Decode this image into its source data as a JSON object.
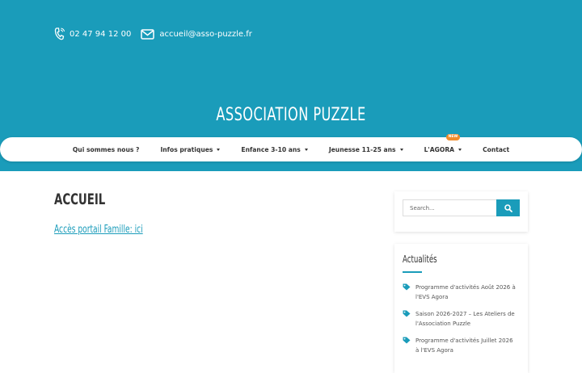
{
  "contact": {
    "phone": "02 47 94 12 00",
    "email": "accueil@asso-puzzle.fr",
    "phone_icon": "phone-icon",
    "email_icon": "envelope-icon"
  },
  "site": {
    "title": "ASSOCIATION PUZZLE"
  },
  "nav": {
    "items": [
      {
        "label": "Qui sommes nous ?",
        "dropdown": false
      },
      {
        "label": "Infos pratiques",
        "dropdown": true
      },
      {
        "label": "Enfance 3-10 ans",
        "dropdown": true
      },
      {
        "label": "Jeunesse 11-25 ans",
        "dropdown": true
      },
      {
        "label": "L'AGORA",
        "dropdown": true,
        "badge": "NEW"
      },
      {
        "label": "Contact",
        "dropdown": false
      }
    ]
  },
  "main": {
    "title": "ACCUEIL",
    "portal_link": "Accès portail Famille: ici"
  },
  "sidebar": {
    "search": {
      "placeholder": "Search...",
      "icon": "search-icon"
    },
    "news": {
      "title": "Actualités",
      "items": [
        "Programme d'activités Août 2026 à l'EVS Agora",
        "Saison 2026-2027 – Les Ateliers de l'Association Puzzle",
        "Programme d'activités Juillet 2026 à l'EVS Agora"
      ]
    }
  },
  "colors": {
    "brand": "#1a9cba",
    "badge": "#f08c2b"
  }
}
